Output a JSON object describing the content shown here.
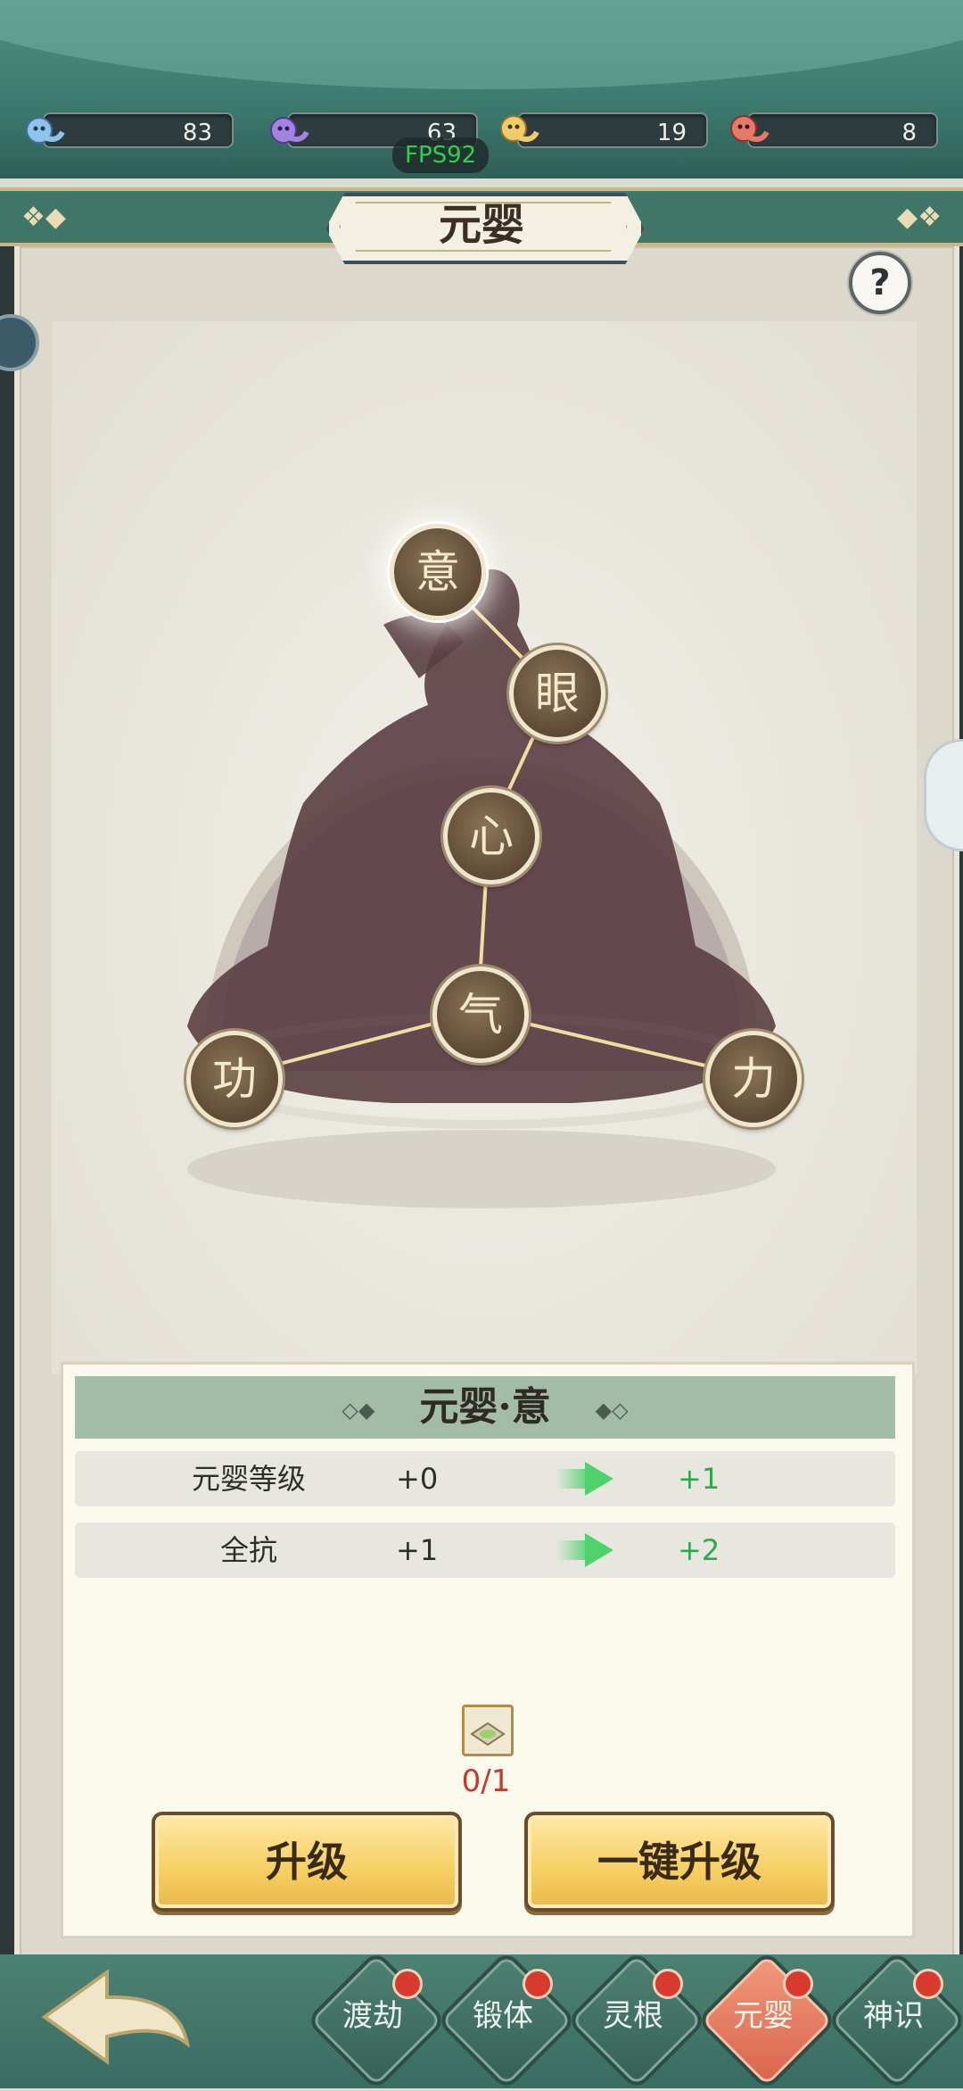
{
  "resources": [
    {
      "icon": "blue-spirit-icon",
      "value": "83",
      "color": "#6aa7d8"
    },
    {
      "icon": "purple-spirit-icon",
      "value": "63",
      "color": "#8a6ad0"
    },
    {
      "icon": "gold-spirit-icon",
      "value": "19",
      "color": "#e6b84a"
    },
    {
      "icon": "red-spirit-icon",
      "value": "8",
      "color": "#d8584a"
    }
  ],
  "fps": "FPS92",
  "title": "元婴",
  "help": "?",
  "nodes": {
    "yi": "意",
    "yan": "眼",
    "xin": "心",
    "qi": "气",
    "gong": "功",
    "li": "力"
  },
  "info": {
    "heading": "元婴·意",
    "stats": [
      {
        "name": "元婴等级",
        "current": "+0",
        "next": "+1"
      },
      {
        "name": "全抗",
        "current": "+1",
        "next": "+2"
      }
    ],
    "cost": "0/1"
  },
  "buttons": {
    "upgrade": "升级",
    "one_key_upgrade": "一键升级"
  },
  "nav": [
    {
      "label": "渡劫",
      "active": false
    },
    {
      "label": "锻体",
      "active": false
    },
    {
      "label": "灵根",
      "active": false
    },
    {
      "label": "元婴",
      "active": true
    },
    {
      "label": "神识",
      "active": false
    }
  ]
}
